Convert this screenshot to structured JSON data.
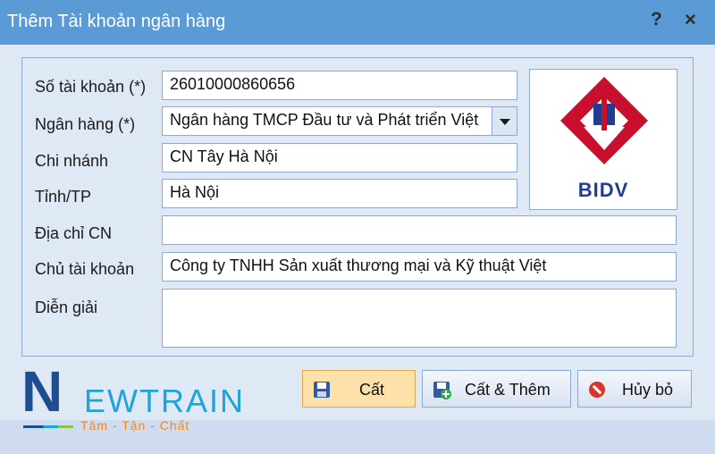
{
  "window": {
    "title": "Thêm Tài khoản ngân hàng",
    "help_label": "?",
    "close_label": "×"
  },
  "form": {
    "account_number": {
      "label": "Số tài khoản (*)",
      "value": "26010000860656"
    },
    "bank": {
      "label": "Ngân hàng (*)",
      "value": "Ngân hàng TMCP Đầu tư và Phát triển Việt"
    },
    "branch": {
      "label": "Chi nhánh",
      "value": "CN Tây Hà Nội"
    },
    "province": {
      "label": "Tỉnh/TP",
      "value": "Hà Nội"
    },
    "branch_address": {
      "label": "Địa chỉ CN",
      "value": ""
    },
    "account_holder": {
      "label": "Chủ tài khoản",
      "value": "Công ty TNHH Sản xuất thương mại và Kỹ thuật Việt"
    },
    "description": {
      "label": "Diễn giải",
      "value": ""
    }
  },
  "bank_logo": {
    "text": "BIDV"
  },
  "buttons": {
    "save": "Cất",
    "save_add": "Cất & Thêm",
    "cancel": "Hủy bỏ"
  },
  "brand": {
    "n": "N",
    "word": "EWTRAIN",
    "tagline": "Tâm - Tận - Chất"
  },
  "colors": {
    "titlebar": "#5b9bd5",
    "panel": "#dfe8f5",
    "bidv_red": "#c8102e",
    "bidv_blue": "#1f3e93",
    "save_button": "#fce2a8"
  }
}
